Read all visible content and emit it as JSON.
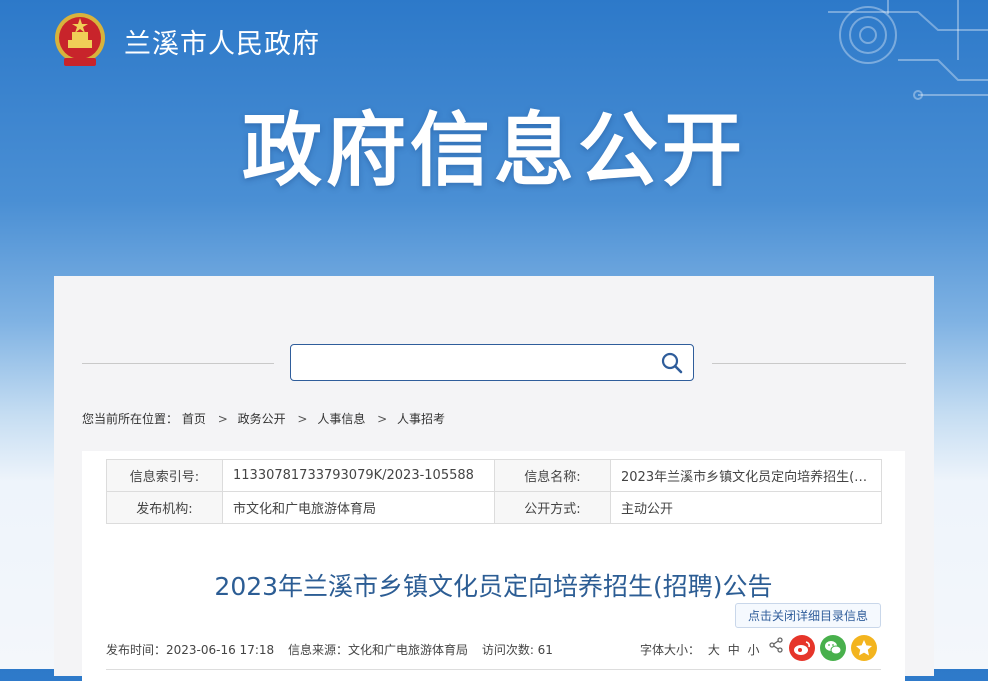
{
  "header": {
    "site_name": "兰溪市人民政府",
    "hero_title": "政府信息公开"
  },
  "search": {
    "value": "",
    "placeholder": ""
  },
  "breadcrumb": {
    "prefix": "您当前所在位置：",
    "items": [
      "首页",
      "政务公开",
      "人事信息",
      "人事招考"
    ]
  },
  "info_table": {
    "index_label": "信息索引号:",
    "index_value": "11330781733793079K/2023-105588",
    "name_label": "信息名称:",
    "name_value": "2023年兰溪市乡镇文化员定向培养招生(招...",
    "org_label": "发布机构:",
    "org_value": "市文化和广电旅游体育局",
    "method_label": "公开方式:",
    "method_value": "主动公开"
  },
  "article": {
    "title": "2023年兰溪市乡镇文化员定向培养招生(招聘)公告",
    "toggle_detail": "点击关闭详细目录信息",
    "publish_time": "发布时间：2023-06-16 17:18",
    "source": "信息来源：文化和广电旅游体育局",
    "visits": "访问次数: 61",
    "font_size_label": "字体大小：",
    "font_large": "大",
    "font_medium": "中",
    "font_small": "小"
  },
  "colors": {
    "brand_blue": "#2d79c9",
    "title_blue": "#2c5d94",
    "weibo_red": "#e6352a",
    "wechat_green": "#48b04c",
    "favorite_yellow": "#f3b41e"
  }
}
